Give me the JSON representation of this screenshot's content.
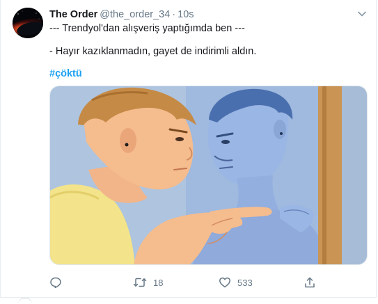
{
  "tweet": {
    "display_name": "The Order",
    "handle": "@the_order_34",
    "separator": "·",
    "time": "10s",
    "lines": [
      "--- Trendyol'dan alışveriş yaptığımda ben ---",
      "- Hayır kazıklanmadın, gayet de indirimli aldın."
    ],
    "hashtag": "#çöktü"
  },
  "actions": {
    "reply_count": "",
    "retweet_count": "18",
    "like_count": "533",
    "share_count": ""
  },
  "icons": {
    "caret": "chevron-down-icon",
    "reply": "reply-icon",
    "retweet": "retweet-icon",
    "like": "heart-icon",
    "share": "share-icon"
  },
  "colors": {
    "accent": "#1da1f2",
    "text_primary": "#14171a",
    "text_secondary": "#657786",
    "border": "#e6ecf0"
  }
}
